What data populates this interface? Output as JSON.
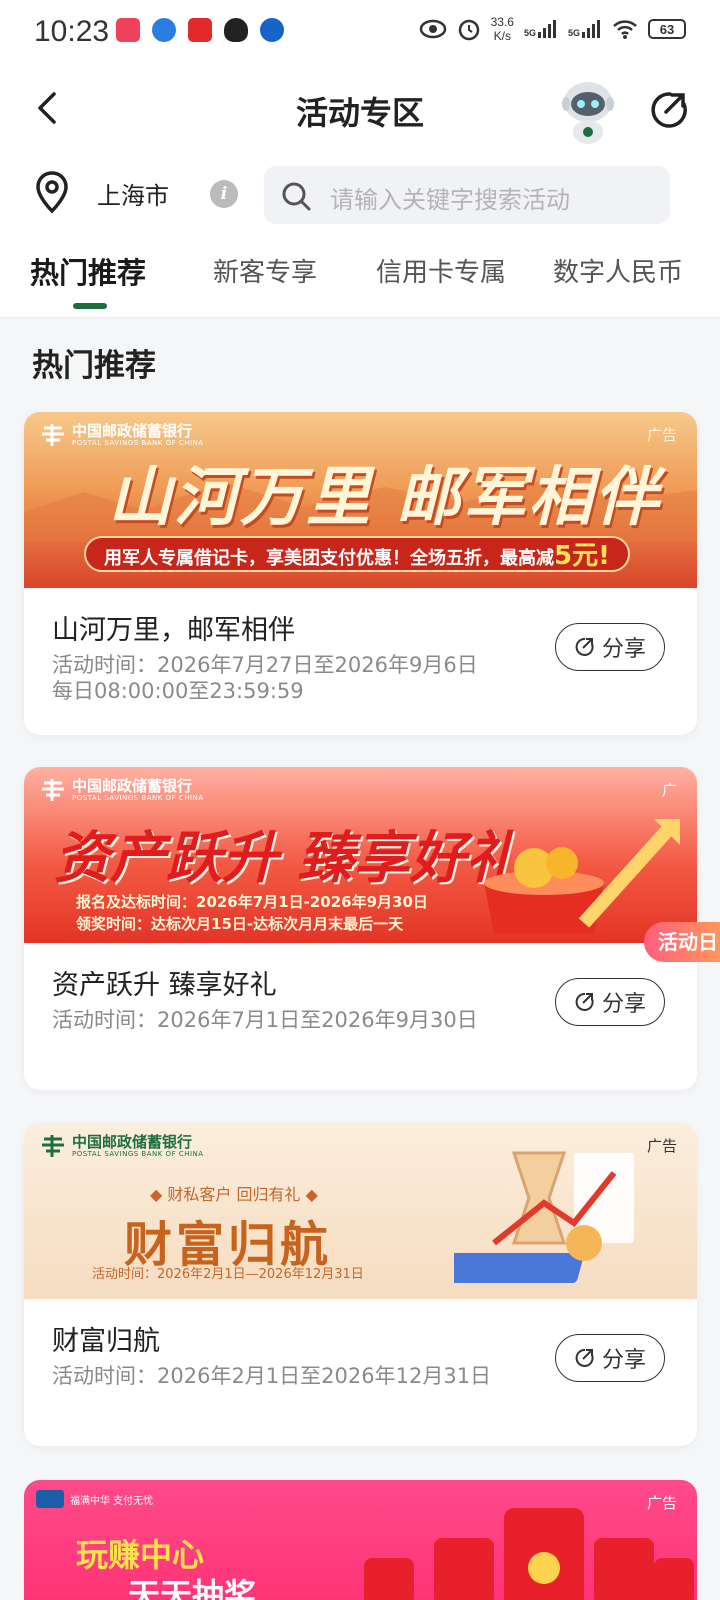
{
  "status_bar": {
    "time": "10:23",
    "speed_value": "33.6",
    "speed_unit": "K/s",
    "signal1": "5G",
    "signal2": "5G",
    "battery": "63"
  },
  "header": {
    "title": "活动专区"
  },
  "location": {
    "city": "上海市"
  },
  "search": {
    "placeholder": "请输入关键字搜索活动"
  },
  "tabs": [
    {
      "label": "热门推荐",
      "active": true
    },
    {
      "label": "新客专享"
    },
    {
      "label": "信用卡专属"
    },
    {
      "label": "数字人民币"
    }
  ],
  "section": {
    "title": "热门推荐"
  },
  "bank": {
    "name_cn": "中国邮政储蓄银行",
    "name_en": "POSTAL SAVINGS BANK OF CHINA"
  },
  "cards": [
    {
      "ad": "广告",
      "banner_headline": "山河万里 邮军相伴",
      "banner_strip": "用军人专属借记卡，享美团支付优惠！全场五折，最高减",
      "banner_strip_amount": "5元!",
      "title": "山河万里，邮军相伴",
      "time": "活动时间：2026年7月27日至2026年9月6日 每日08:00:00至23:59:59",
      "share": "分享"
    },
    {
      "ad": "广",
      "banner_headline": "资产跃升 臻享好礼",
      "banner_line1": "报名及达标时间：2026年7月1日-2026年9月30日",
      "banner_line2": "领奖时间：达标次月15日-达标次月月末最后一天",
      "title": "资产跃升 臻享好礼",
      "time": "活动时间：2026年7月1日至2026年9月30日",
      "share": "分享"
    },
    {
      "ad": "广告",
      "banner_sub": "◆ 财私客户 回归有礼 ◆",
      "banner_headline": "财富归航",
      "banner_dates": "活动时间：2026年2月1日—2026年12月31日",
      "title": "财富归航",
      "time": "活动时间：2026年2月1日至2026年12月31日",
      "share": "分享"
    },
    {
      "ad": "广告",
      "banner_tagline": "福满中华 支付无忧",
      "banner_line1": "玩赚中心",
      "banner_line2": "天天抽奖"
    }
  ],
  "float_button": {
    "label": "活动日"
  },
  "colors": {
    "accent_green": "#1d6f40",
    "bank_red": "#c8261a"
  }
}
